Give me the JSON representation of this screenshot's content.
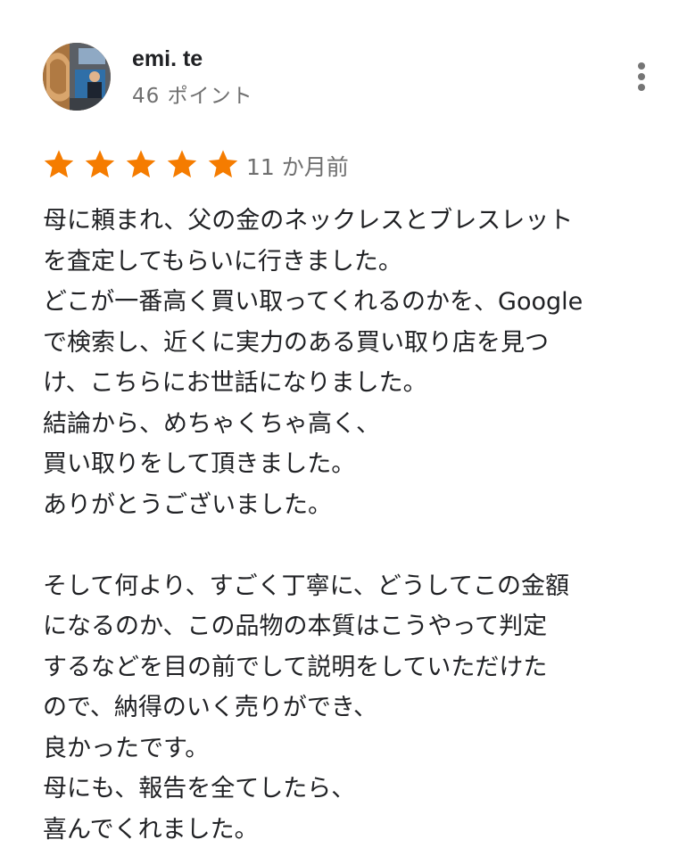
{
  "author": {
    "name": "emi. te",
    "points": "46 ポイント"
  },
  "rating": {
    "value": 5,
    "max": 5,
    "color": "#f57c00"
  },
  "review": {
    "date": "11 か月前",
    "lines": [
      "母に頼まれ、父の金のネックレスとブレスレット",
      "を査定してもらいに行きました。",
      "どこが一番高く買い取ってくれるのかを、Google",
      "で検索し、近くに実力のある買い取り店を見つ",
      "け、こちらにお世話になりました。",
      "結論から、めちゃくちゃ高く、",
      "買い取りをして頂きました。",
      "ありがとうございました。",
      "",
      "そして何より、すごく丁寧に、どうしてこの金額",
      "になるのか、この品物の本質はこうやって判定",
      "するなどを目の前でして説明をしていただけた",
      "ので、納得のいく売りができ、",
      "良かったです。",
      "母にも、報告を全てしたら、",
      "喜んでくれました。"
    ]
  },
  "icons": {
    "menu": "more-vert-icon",
    "star": "star-icon"
  }
}
